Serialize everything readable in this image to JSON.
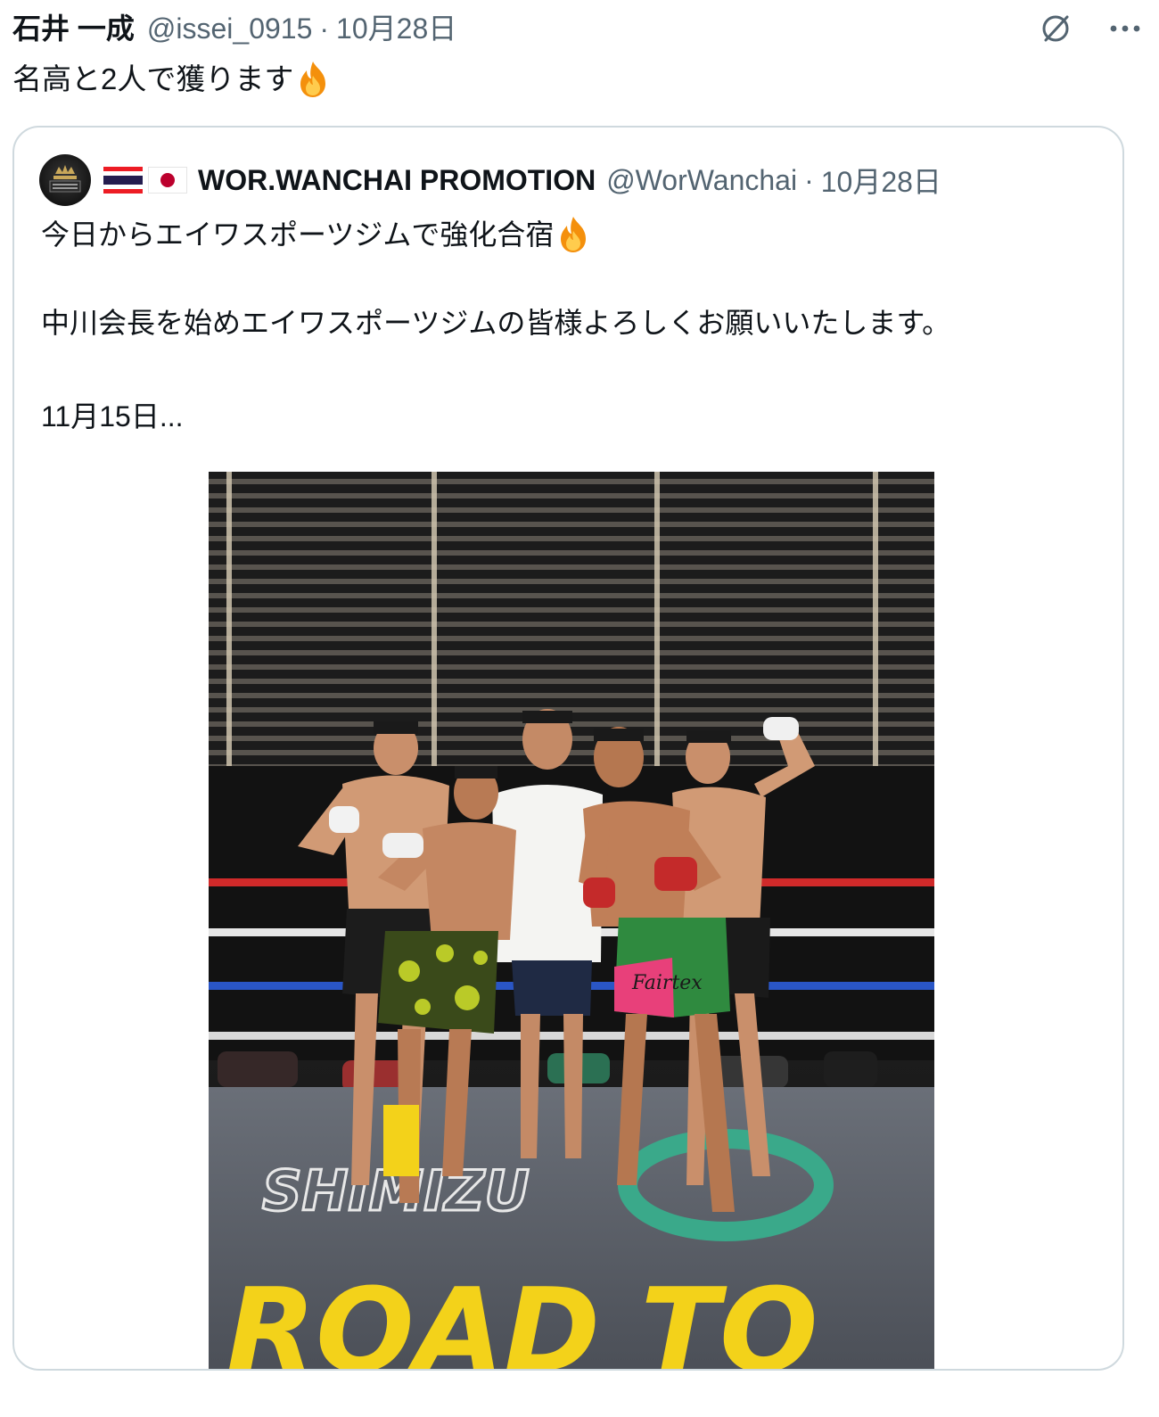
{
  "tweet": {
    "author_name": "石井 一成",
    "author_handle": "@issei_0915",
    "separator": "·",
    "date": "10月28日",
    "text": "名高と2人で獲ります",
    "emoji": "fire-emoji"
  },
  "actions": {
    "grok_icon": "grok-slash-icon",
    "more_icon": "more-icon",
    "more_glyph": "···"
  },
  "quote": {
    "author_name": "WOR.WANCHAI PROMOTION",
    "author_handle": "@WorWanchai",
    "separator": "·",
    "date": "10月28日",
    "flags": [
      "thailand-flag",
      "japan-flag"
    ],
    "line1": "今日からエイワスポーツジムで強化合宿",
    "line1_emoji": "fire-emoji",
    "line2": "中川会長を始めエイワスポーツジムの皆様よろしくお願いいたします。",
    "line3": "11月15日...",
    "photo": {
      "floor_text_1": "SHIMIZU",
      "floor_text_2": "ROAD TO",
      "shorts_brand": "Fairtex"
    }
  },
  "colors": {
    "text_primary": "#0f1419",
    "text_secondary": "#536471",
    "border": "#cfd9de",
    "ring_red": "#d02a2a",
    "ring_blue": "#2a56c6",
    "floor_yellow": "#f3d21a",
    "floor_teal": "#3aa98a"
  }
}
